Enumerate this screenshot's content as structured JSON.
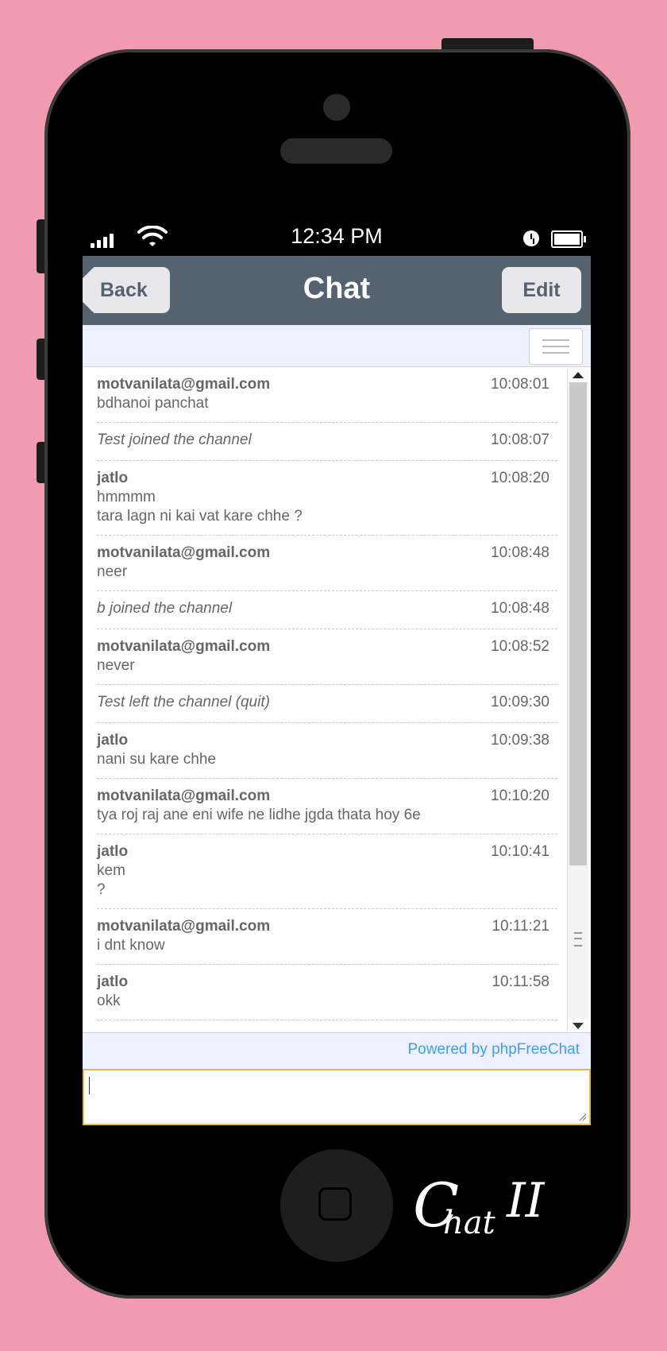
{
  "status_bar": {
    "time": "12:34 PM",
    "signal_icon": "signal-bars-icon",
    "wifi_icon": "wifi-icon",
    "alarm_icon": "alarm-clock-icon",
    "battery_icon": "battery-full-icon"
  },
  "nav": {
    "title": "Chat",
    "back_label": "Back",
    "edit_label": "Edit"
  },
  "toolbar": {
    "menu_icon": "hamburger-menu-icon"
  },
  "messages": [
    {
      "type": "message",
      "sender": "motvanilata@gmail.com",
      "time": "10:08:01",
      "lines": [
        "bdhanoi panchat"
      ]
    },
    {
      "type": "event",
      "text": "Test joined the channel",
      "time": "10:08:07"
    },
    {
      "type": "message",
      "sender": "jatlo",
      "time": "10:08:20",
      "lines": [
        "hmmmm",
        "tara lagn ni kai vat kare chhe ?"
      ]
    },
    {
      "type": "message",
      "sender": "motvanilata@gmail.com",
      "time": "10:08:48",
      "lines": [
        "neer"
      ]
    },
    {
      "type": "event",
      "text": "b joined the channel",
      "time": "10:08:48"
    },
    {
      "type": "message",
      "sender": "motvanilata@gmail.com",
      "time": "10:08:52",
      "lines": [
        "never"
      ]
    },
    {
      "type": "event",
      "text": "Test left the channel (quit)",
      "time": "10:09:30"
    },
    {
      "type": "message",
      "sender": "jatlo",
      "time": "10:09:38",
      "lines": [
        "nani su kare chhe"
      ]
    },
    {
      "type": "message",
      "sender": "motvanilata@gmail.com",
      "time": "10:10:20",
      "lines": [
        "tya roj raj ane eni wife ne lidhe jgda thata hoy 6e"
      ]
    },
    {
      "type": "message",
      "sender": "jatlo",
      "time": "10:10:41",
      "lines": [
        "kem",
        "?"
      ]
    },
    {
      "type": "message",
      "sender": "motvanilata@gmail.com",
      "time": "10:11:21",
      "lines": [
        "i dnt know"
      ]
    },
    {
      "type": "message",
      "sender": "jatlo",
      "time": "10:11:58",
      "lines": [
        "okk"
      ]
    }
  ],
  "footer": {
    "powered_by": "Powered by phpFreeChat"
  },
  "input": {
    "value": "",
    "placeholder": ""
  },
  "branding": {
    "logo_c": "C",
    "logo_hat": "hat",
    "logo_ii": "II"
  },
  "colors": {
    "background": "#f19bb0",
    "navbar": "#556270",
    "link": "#3ea0e8",
    "input_border": "#e6b858"
  }
}
